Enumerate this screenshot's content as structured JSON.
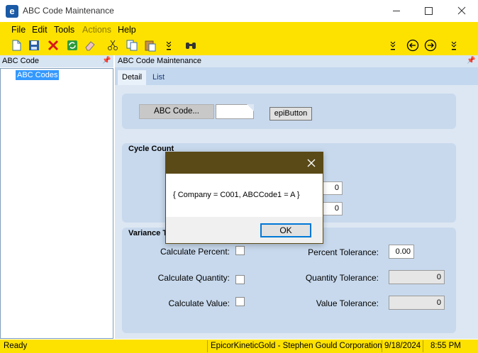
{
  "window": {
    "title": "ABC Code Maintenance",
    "app_icon_letter": "e"
  },
  "menu": {
    "items": [
      "File",
      "Edit",
      "Tools",
      "Actions",
      "Help"
    ]
  },
  "left_panel": {
    "header": "ABC Code",
    "tree_item": "ABC Codes"
  },
  "right_panel": {
    "header": "ABC Code Maintenance",
    "tabs": [
      "Detail",
      "List"
    ],
    "abc_code_button": "ABC Code...",
    "abc_code_value": "",
    "epi_button": "epiButton",
    "cycle_count": {
      "title": "Cycle Count",
      "field1": "0",
      "field2": "0"
    },
    "variance": {
      "title": "Variance T",
      "calc_percent": "Calculate Percent:",
      "calc_quantity": "Calculate Quantity:",
      "calc_value": "Calculate Value:",
      "percent_tolerance_label": "Percent Tolerance:",
      "percent_tolerance": "0.00",
      "quantity_tolerance_label": "Quantity Tolerance:",
      "quantity_tolerance": "0",
      "value_tolerance_label": "Value Tolerance:",
      "value_tolerance": "0"
    }
  },
  "dialog": {
    "message": "{ Company = C001, ABCCode1 = A }",
    "ok_label": "OK"
  },
  "status": {
    "ready": "Ready",
    "company": "EpicorKineticGold - Stephen Gould Corporation",
    "date": "9/18/2024",
    "time": "8:55 PM"
  },
  "colors": {
    "accent": "#fde200",
    "dialog_title": "#5a4a18",
    "selection": "#3399ff"
  }
}
